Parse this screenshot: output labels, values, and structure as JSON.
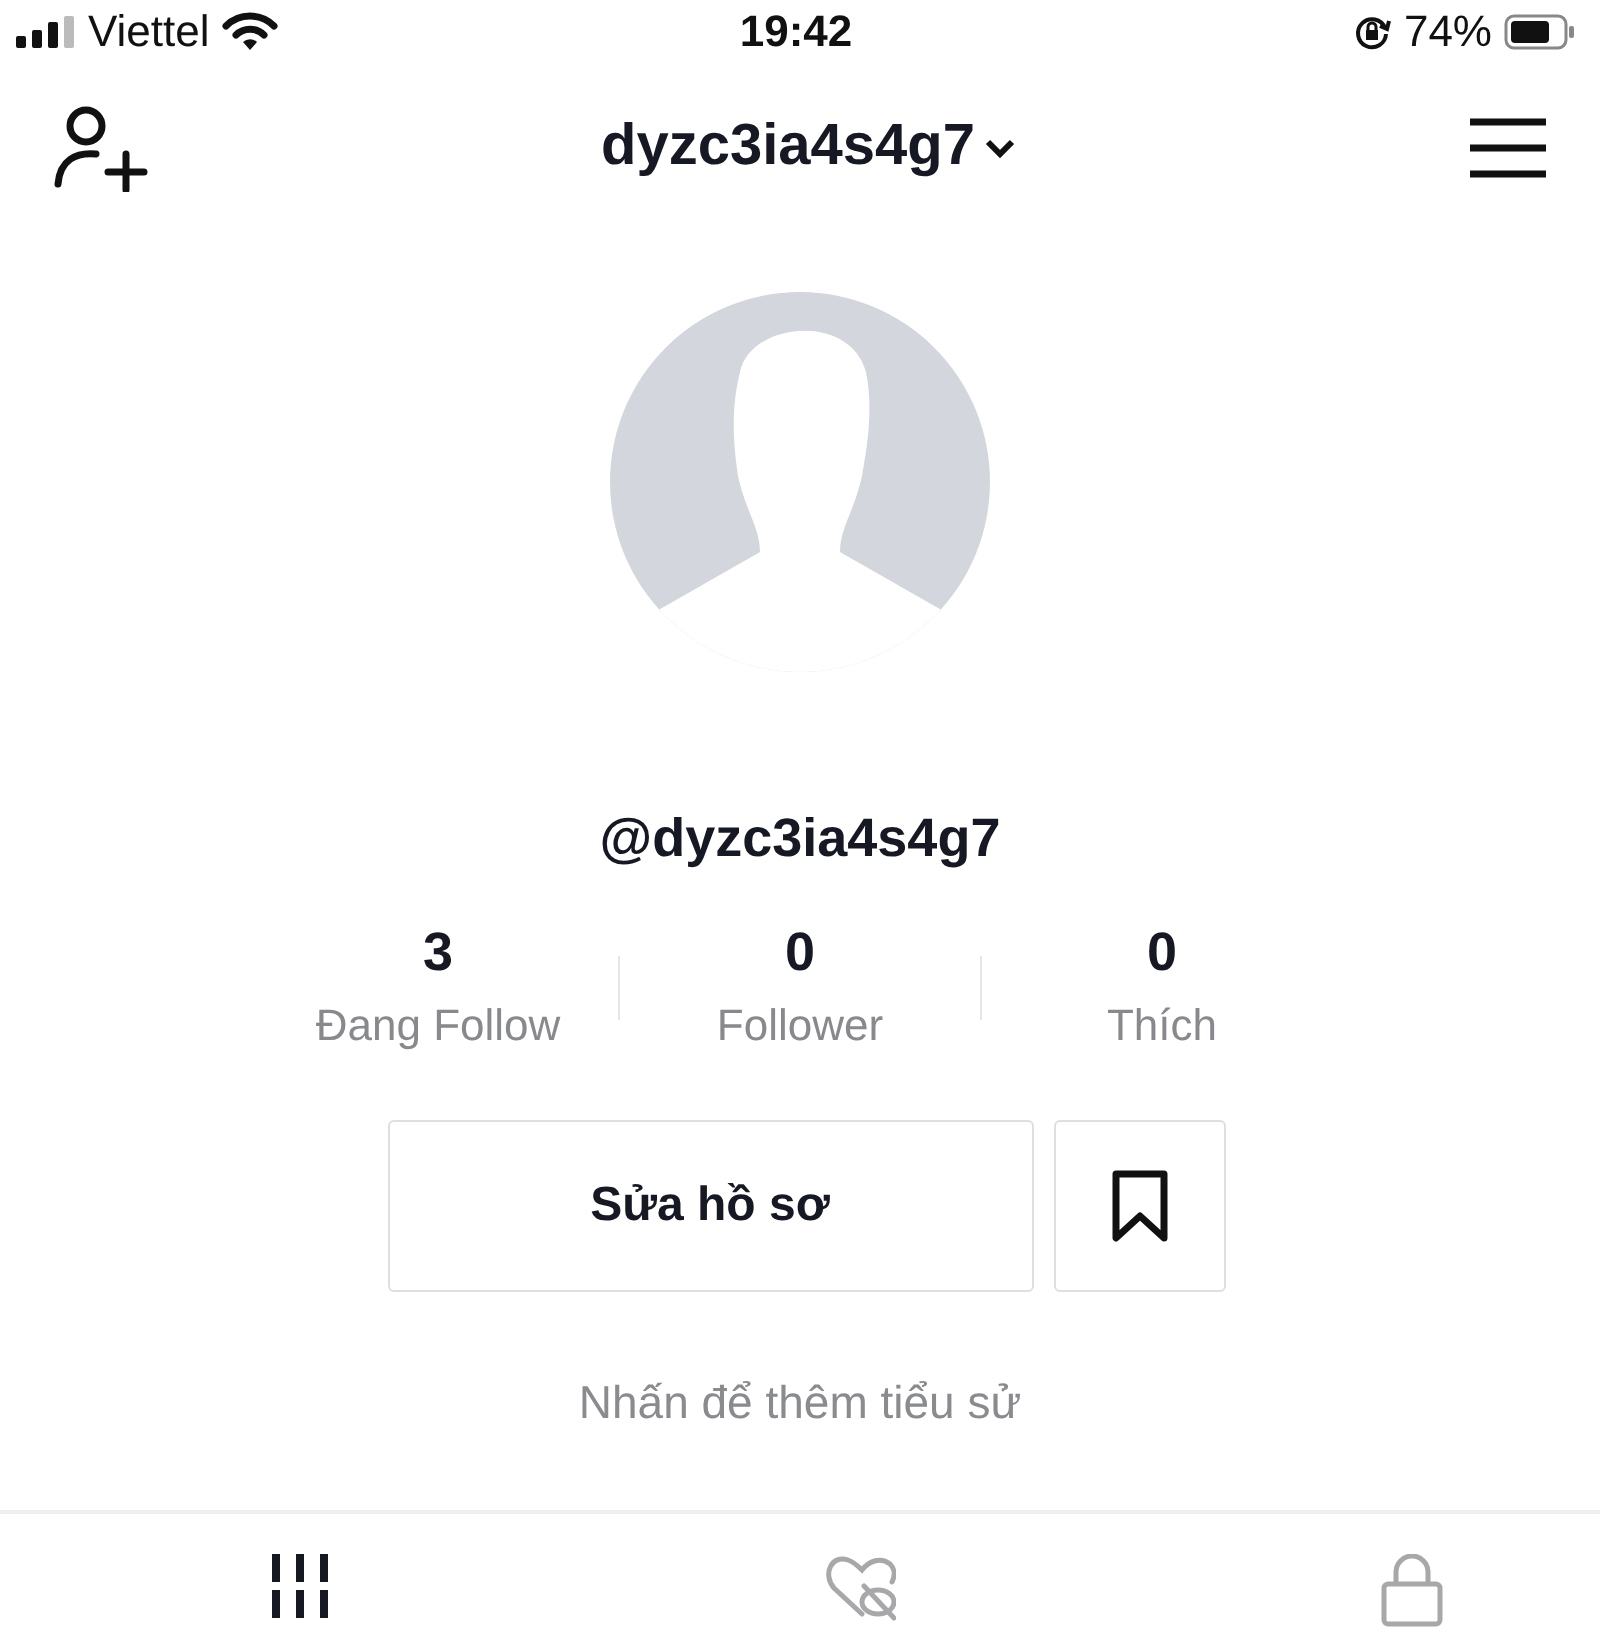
{
  "status_bar": {
    "carrier": "Viettel",
    "time": "19:42",
    "battery": "74%"
  },
  "header": {
    "username": "dyzc3ia4s4g7"
  },
  "profile": {
    "handle": "@dyzc3ia4s4g7"
  },
  "stats": [
    {
      "value": "3",
      "label": "Đang Follow"
    },
    {
      "value": "0",
      "label": "Follower"
    },
    {
      "value": "0",
      "label": "Thích"
    }
  ],
  "edit_button": "Sửa hồ sơ",
  "bio_prompt": "Nhấn để thêm tiểu sử",
  "tabs": [
    {
      "kind": "videos",
      "selected": true
    },
    {
      "kind": "liked",
      "selected": false
    },
    {
      "kind": "private",
      "selected": false
    }
  ]
}
